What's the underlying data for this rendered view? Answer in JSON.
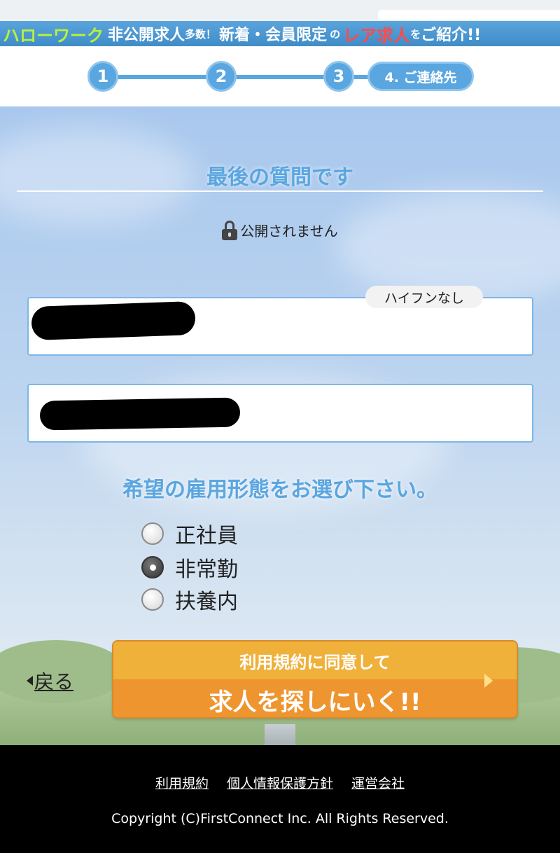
{
  "banner": {
    "hellowork": "ハローワーク",
    "part1": "非公開求人",
    "part2": "多数",
    "part3": "！",
    "part4": "新着・会員限定",
    "part5": "の",
    "rare": "レア求人",
    "part6": "を",
    "part7": "ご紹介!!"
  },
  "steps": {
    "items": [
      "1",
      "2",
      "3"
    ],
    "active_label": "4. ご連絡先"
  },
  "question": {
    "title": "最後の質問です",
    "privacy_note": "公開されません"
  },
  "form": {
    "phone_hint": "ハイフンなし",
    "phone_value": "",
    "email_value": ""
  },
  "employment": {
    "title": "希望の雇用形態をお選び下さい。",
    "options": [
      {
        "label": "正社員",
        "checked": false
      },
      {
        "label": "非常勤",
        "checked": true
      },
      {
        "label": "扶養内",
        "checked": false
      }
    ]
  },
  "actions": {
    "back_label": "戻る",
    "cta_top": "利用規約に同意して",
    "cta_main": "求人を探しにいく!!"
  },
  "footer": {
    "links": [
      "利用規約",
      "個人情報保護方針",
      "運営会社"
    ],
    "copyright": "Copyright (C)FirstConnect Inc. All Rights Reserved."
  },
  "colors": {
    "accent_blue": "#5aa6e0",
    "cta_orange": "#ee9530",
    "cta_yellow": "#f0b13b",
    "rare_red": "#ff4a4a",
    "hellowork_green": "#b9f23a"
  }
}
